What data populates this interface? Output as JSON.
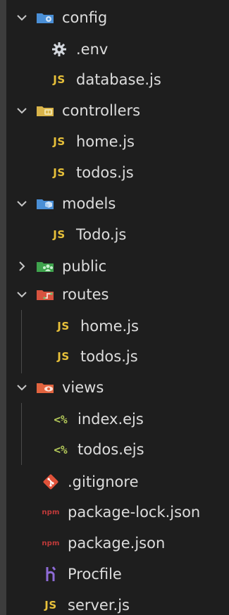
{
  "explorer": {
    "items": [
      {
        "label": "config",
        "icon": "folder-config-icon",
        "chevron": "chevron-down-icon"
      },
      {
        "label": ".env",
        "icon": "gear-icon"
      },
      {
        "label": "database.js",
        "icon": "js-file-icon",
        "badge": "JS"
      },
      {
        "label": "controllers",
        "icon": "folder-controllers-icon",
        "chevron": "chevron-down-icon"
      },
      {
        "label": "home.js",
        "icon": "js-file-icon",
        "badge": "JS"
      },
      {
        "label": "todos.js",
        "icon": "js-file-icon",
        "badge": "JS"
      },
      {
        "label": "models",
        "icon": "folder-models-icon",
        "chevron": "chevron-down-icon"
      },
      {
        "label": "Todo.js",
        "icon": "js-file-icon",
        "badge": "JS"
      },
      {
        "label": "public",
        "icon": "folder-public-icon",
        "chevron": "chevron-right-icon"
      },
      {
        "label": "routes",
        "icon": "folder-routes-icon",
        "chevron": "chevron-down-icon"
      },
      {
        "label": "home.js",
        "icon": "js-file-icon",
        "badge": "JS"
      },
      {
        "label": "todos.js",
        "icon": "js-file-icon",
        "badge": "JS"
      },
      {
        "label": "views",
        "icon": "folder-views-icon",
        "chevron": "chevron-down-icon"
      },
      {
        "label": "index.ejs",
        "icon": "ejs-file-icon",
        "badge": "<%"
      },
      {
        "label": "todos.ejs",
        "icon": "ejs-file-icon",
        "badge": "<%"
      },
      {
        "label": ".gitignore",
        "icon": "git-icon"
      },
      {
        "label": "package-lock.json",
        "icon": "npm-icon",
        "badge": "npm"
      },
      {
        "label": "package.json",
        "icon": "npm-icon",
        "badge": "npm"
      },
      {
        "label": "Procfile",
        "icon": "heroku-icon"
      },
      {
        "label": "server.js",
        "icon": "js-file-icon",
        "badge": "JS"
      }
    ]
  },
  "colors": {
    "background": "#1e1e1e",
    "text": "#dddddd",
    "js_yellow": "#e8c13a",
    "ejs_green": "#b4c95a",
    "npm_red": "#c13a3a",
    "folder_blue": "#4a8fd6",
    "folder_green": "#3fa34d",
    "folder_red": "#d7533f",
    "git_red": "#e0523a",
    "heroku_purple": "#8e6bd6"
  }
}
